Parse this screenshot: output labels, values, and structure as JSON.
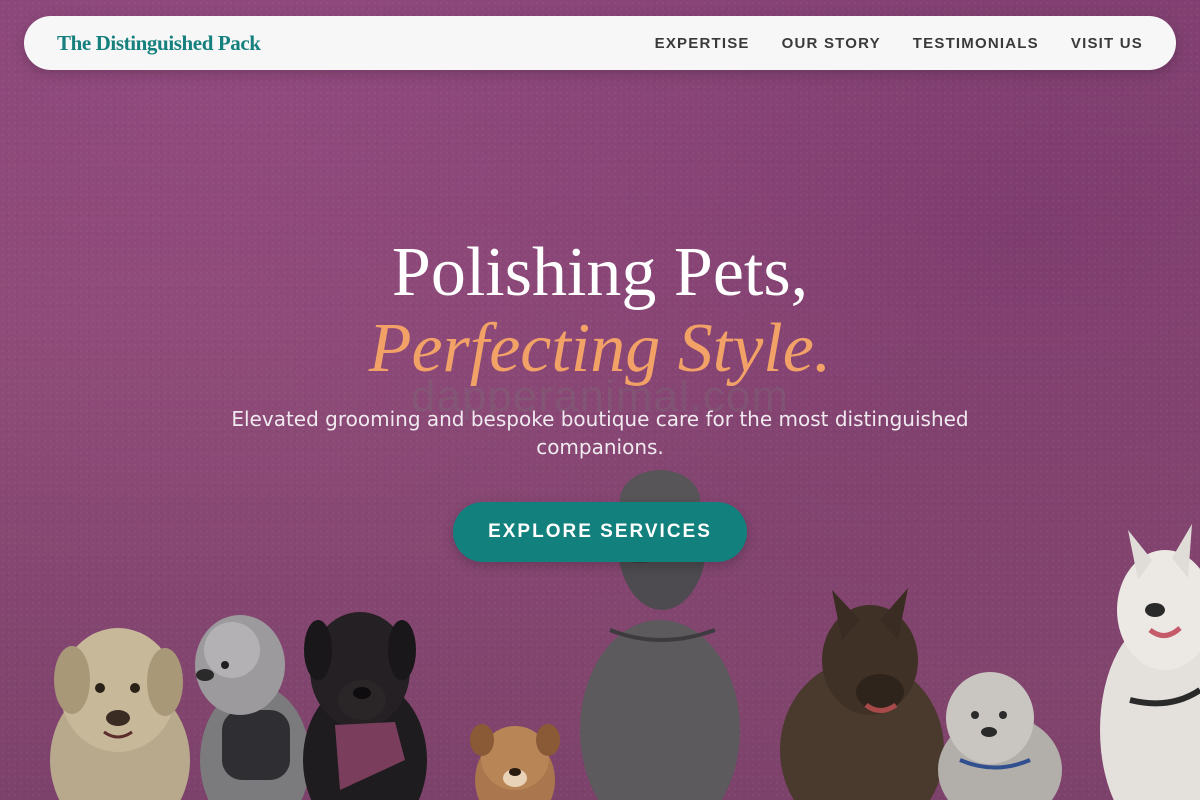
{
  "navbar": {
    "brand": "The Distinguished Pack",
    "links": [
      {
        "label": "EXPERTISE"
      },
      {
        "label": "OUR STORY"
      },
      {
        "label": "TESTIMONIALS"
      },
      {
        "label": "VISIT US"
      }
    ]
  },
  "hero": {
    "headline_line1": "Polishing Pets,",
    "headline_line2": "Perfecting Style.",
    "watermark": "dapperanimal.com",
    "subtitle": "Elevated grooming and bespoke boutique care for the most distinguished companions.",
    "cta_label": "EXPLORE SERVICES"
  },
  "colors": {
    "brand": "#15807d",
    "accent": "#f2a266",
    "cta_background": "#12807c",
    "hero_background": "#8e4b7a"
  }
}
